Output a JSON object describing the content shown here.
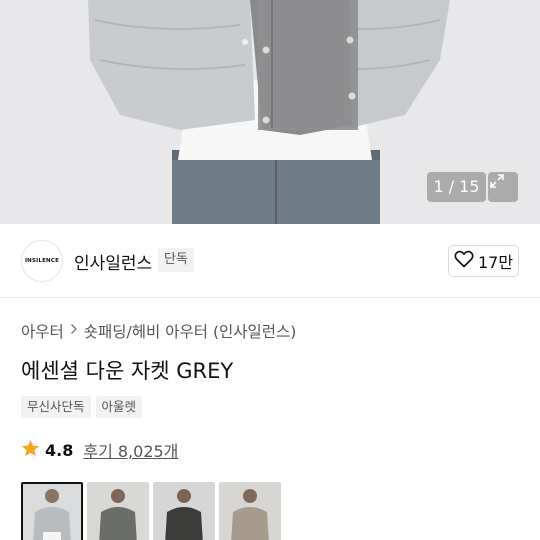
{
  "gallery": {
    "counter": "1 / 15",
    "expand_icon": "expand-icon"
  },
  "brand": {
    "logo_text": "INSILENCE",
    "name": "인사일런스",
    "tag": "단독",
    "like_icon": "heart-outline-icon",
    "like_count": "17만"
  },
  "breadcrumb": {
    "items": [
      "아우터",
      "숏패딩/헤비 아우터 (인사일런스)"
    ],
    "separator_icon": "chevron-right-icon"
  },
  "product": {
    "title": "에센셜 다운 자켓 GREY",
    "tags": [
      "무신사단독",
      "아울렛"
    ]
  },
  "rating": {
    "star_icon": "star-icon",
    "star_color": "#f5a623",
    "value": "4.8",
    "review_link": "후기 8,025개"
  },
  "thumbnails": [
    {
      "color": "#b9bcbf",
      "label": "grey",
      "active": true
    },
    {
      "color": "#6b6e68",
      "label": "charcoal",
      "active": false
    },
    {
      "color": "#3a3a38",
      "label": "black",
      "active": false
    },
    {
      "color": "#a69b8c",
      "label": "beige",
      "active": false
    }
  ]
}
